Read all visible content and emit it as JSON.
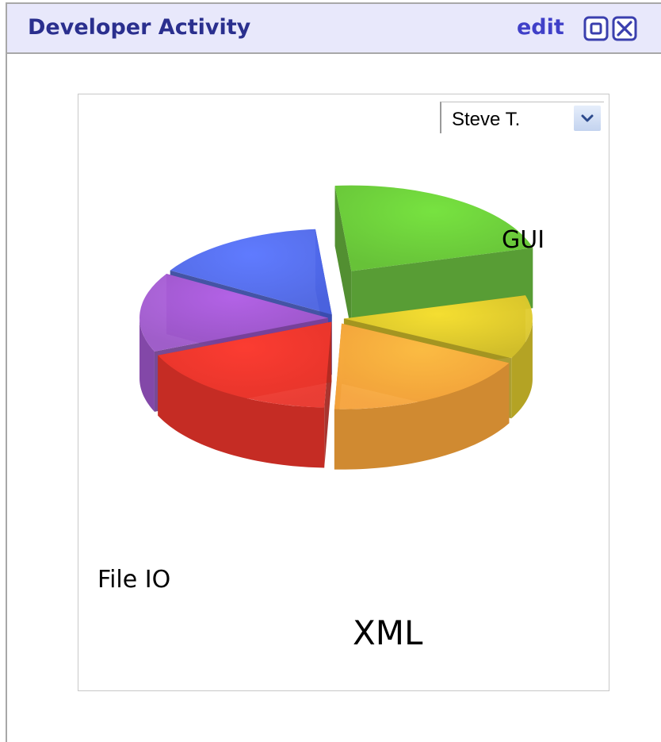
{
  "header": {
    "title": "Developer Activity",
    "edit_label": "edit",
    "maximize_icon": "maximize-icon",
    "close_icon": "close-icon"
  },
  "developer_select": {
    "selected": "Steve T.",
    "icon": "chevron-down-icon"
  },
  "colors": {
    "header_bg": "#e8e8fb",
    "title": "#2a2f8e",
    "accent": "#4040c8"
  },
  "chart_data": {
    "type": "pie",
    "style": "3d-exploded",
    "title": "",
    "slices": [
      {
        "label": "GUI",
        "value": 22,
        "color": "#5fbf2e"
      },
      {
        "label": "",
        "value": 12,
        "color": "#d4c02a"
      },
      {
        "label": "XML",
        "value": 18,
        "color": "#f5a23a"
      },
      {
        "label": "File IO",
        "value": 18,
        "color": "#e8342a"
      },
      {
        "label": "",
        "value": 15,
        "color": "#9a55c6"
      },
      {
        "label": "",
        "value": 15,
        "color": "#4a62e0"
      }
    ]
  }
}
